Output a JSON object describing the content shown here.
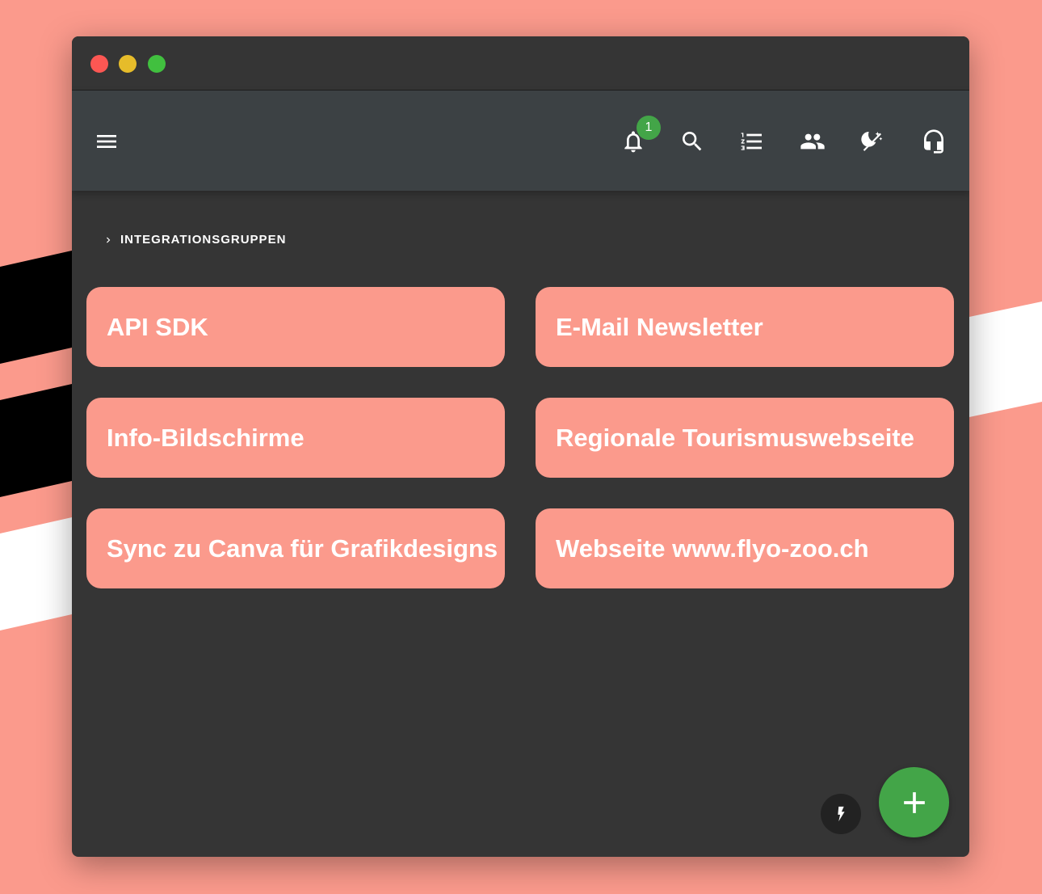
{
  "colors": {
    "background": "#fb9a8c",
    "window": "#353535",
    "toolbar": "#3c4144",
    "card": "#fb9a8c",
    "accent_green": "#43a548"
  },
  "toolbar": {
    "menu_icon": "menu-icon",
    "icons": [
      "bell-icon",
      "search-icon",
      "numbered-list-icon",
      "people-icon",
      "theme-toggle-icon",
      "headset-icon"
    ],
    "notification_count": "1"
  },
  "breadcrumb": {
    "label": "INTEGRATIONSGRUPPEN"
  },
  "groups": [
    {
      "label": "API SDK"
    },
    {
      "label": "E-Mail Newsletter"
    },
    {
      "label": "Info-Bildschirme"
    },
    {
      "label": "Regionale Tourismuswebseite"
    },
    {
      "label": "Sync zu Canva für Grafikdesigns"
    },
    {
      "label": "Webseite www.flyo-zoo.ch"
    }
  ],
  "actions": {
    "secondary_icon": "bolt-icon",
    "primary_icon": "plus-icon"
  }
}
